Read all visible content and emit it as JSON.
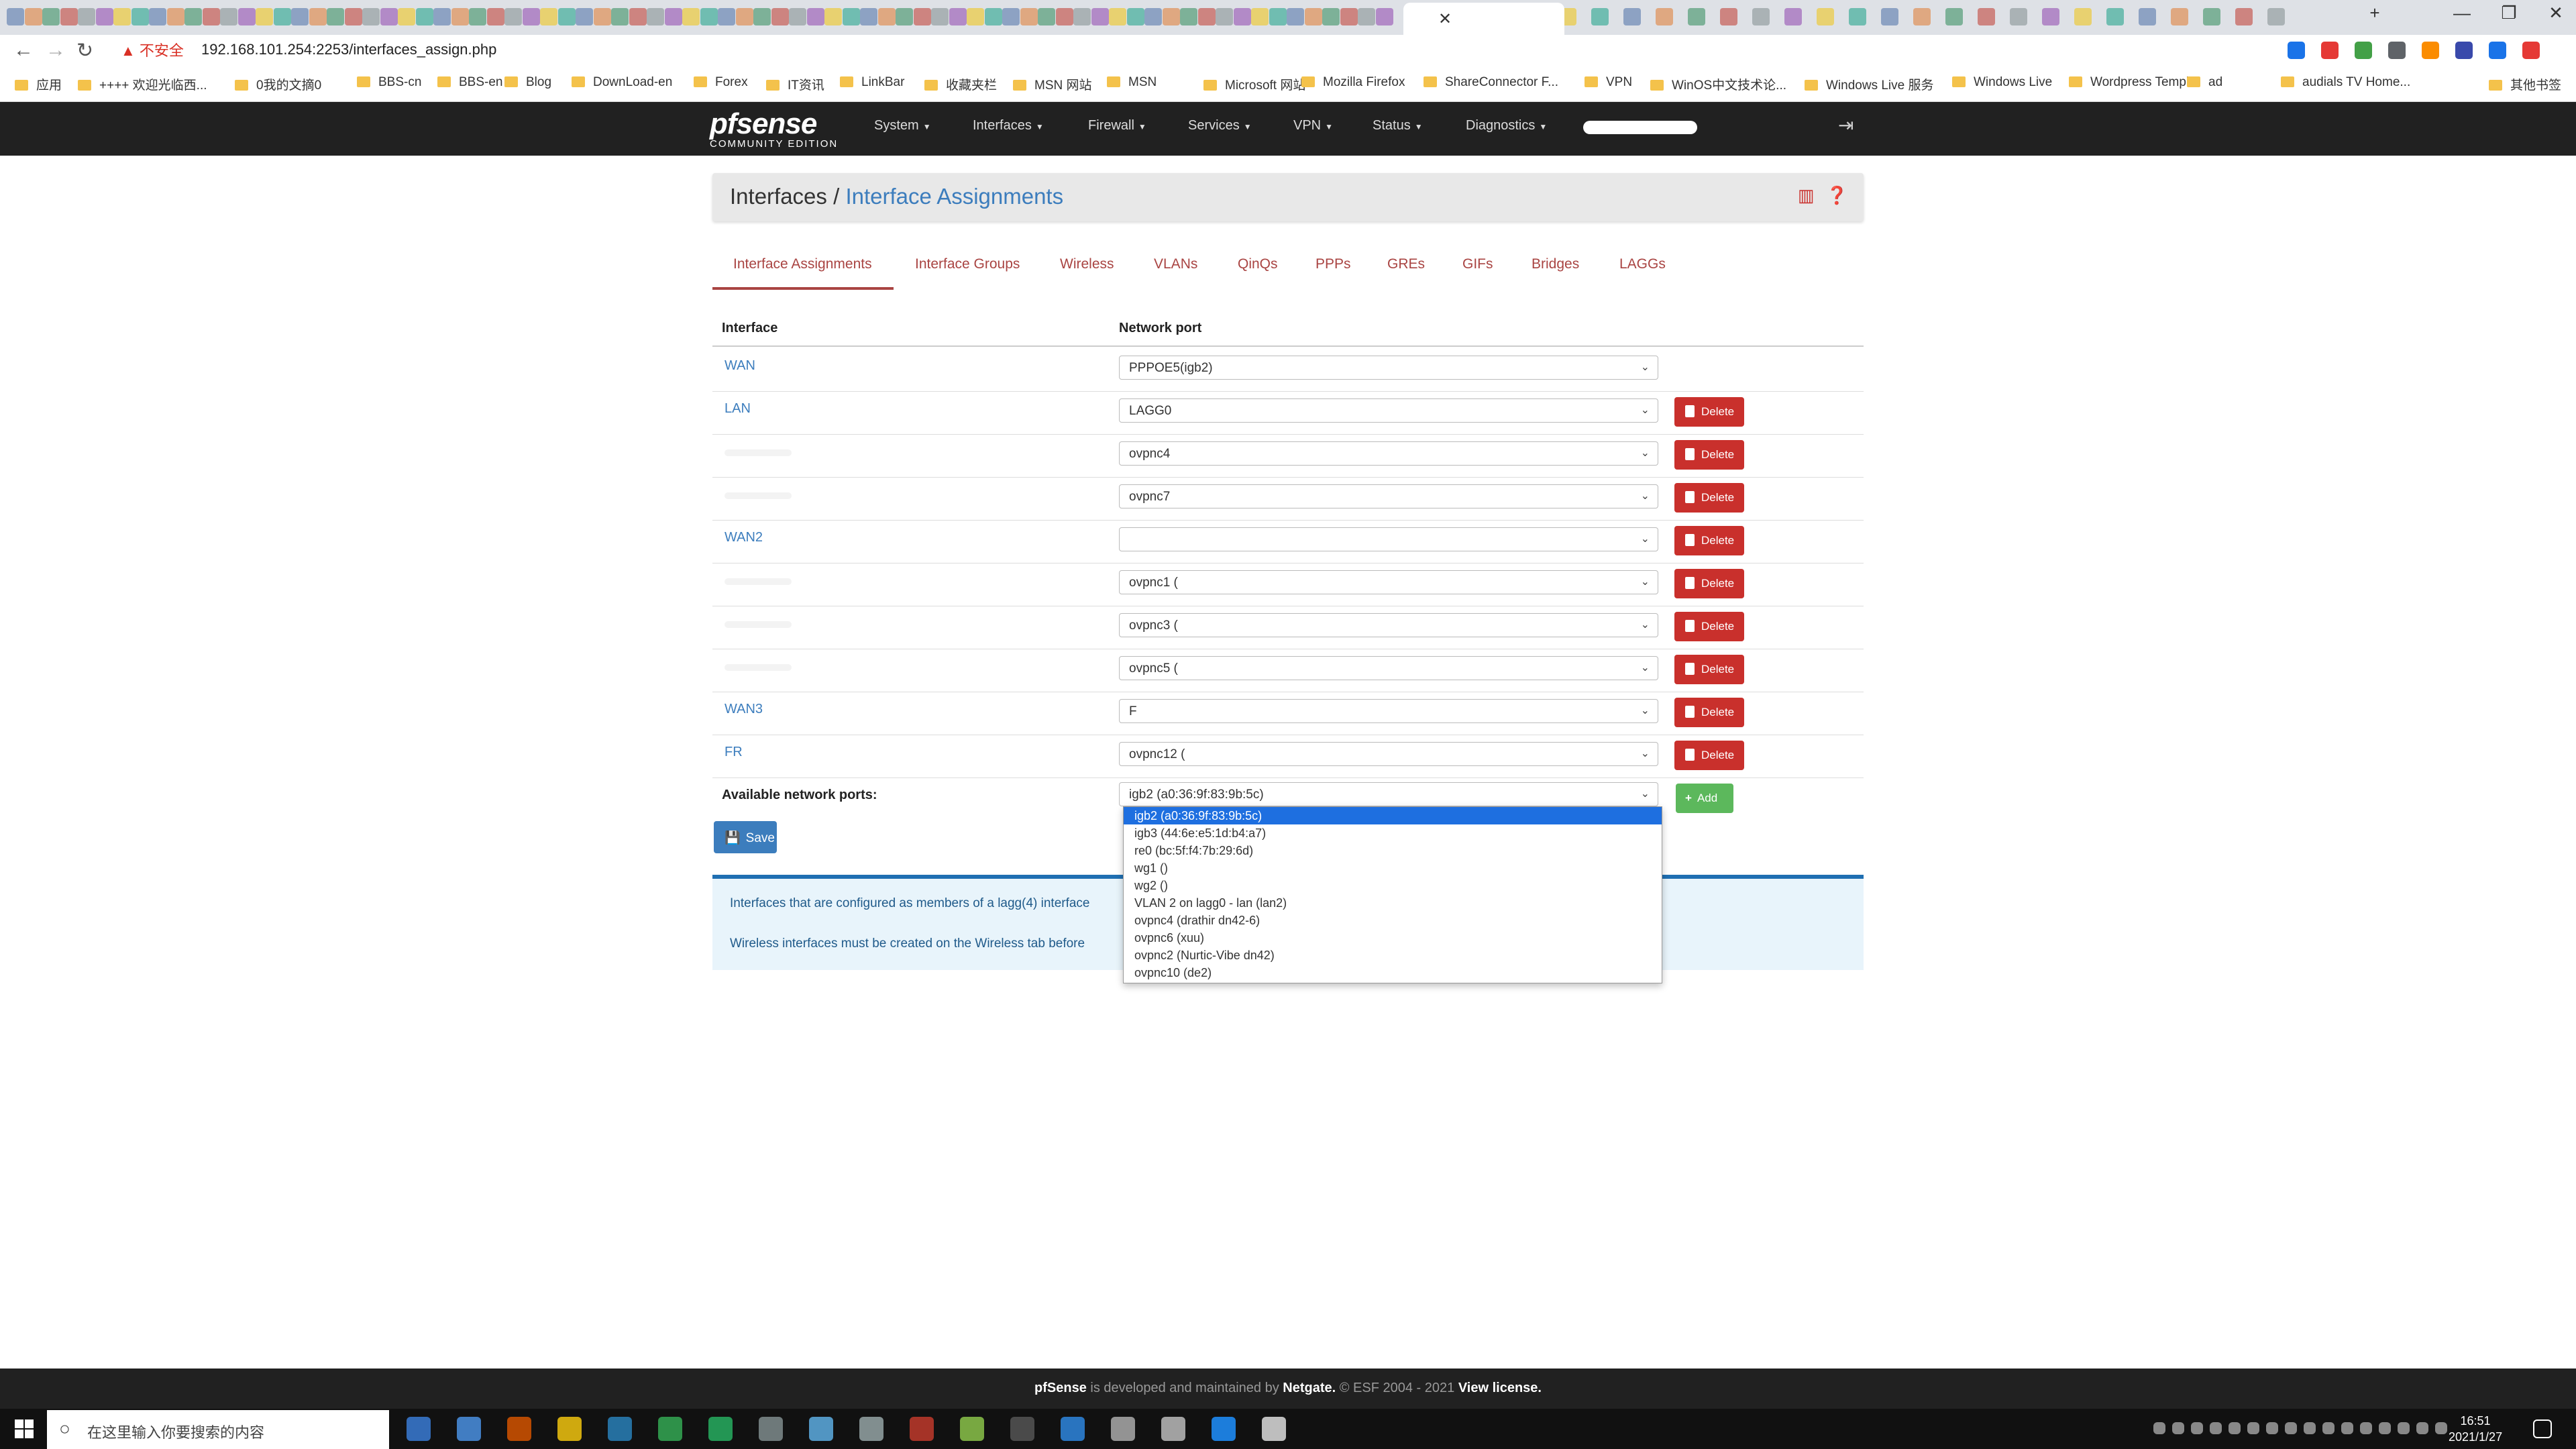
{
  "browser": {
    "url_warning": "不安全",
    "url": "192.168.101.254:2253/interfaces_assign.php",
    "bookmarks": [
      "应用",
      "++++ 欢迎光临西...",
      "0我的文摘0",
      "BBS-cn",
      "BBS-en",
      "Blog",
      "DownLoad-en",
      "Forex",
      "IT资讯",
      "LinkBar",
      "收藏夹栏",
      "MSN 网站",
      "MSN",
      "Microsoft 网站",
      "Mozilla Firefox",
      "ShareConnector F...",
      "VPN",
      "WinOS中文技术论...",
      "Windows Live 服务",
      "Windows Live",
      "Wordpress Templ...",
      "ad",
      "audials TV Home...",
      "其他书签"
    ]
  },
  "navbar": {
    "logo": "pfsense",
    "logo_sub": "COMMUNITY EDITION",
    "menu": [
      "System",
      "Interfaces",
      "Firewall",
      "Services",
      "VPN",
      "Status",
      "Diagnostics"
    ]
  },
  "header": {
    "title": "Interfaces",
    "separator": "/",
    "subtitle": "Interface Assignments"
  },
  "tabs": [
    "Interface Assignments",
    "Interface Groups",
    "Wireless",
    "VLANs",
    "QinQs",
    "PPPs",
    "GREs",
    "GIFs",
    "Bridges",
    "LAGGs"
  ],
  "table": {
    "col_interface": "Interface",
    "col_port": "Network port",
    "delete_label": "Delete",
    "rows": [
      {
        "name": "WAN",
        "port": "PPPOE5(igb2)"
      },
      {
        "name": "LAN",
        "port": "LAGG0"
      },
      {
        "name": "",
        "port": "ovpnc4"
      },
      {
        "name": "",
        "port": "ovpnc7"
      },
      {
        "name": "WAN2",
        "port": ""
      },
      {
        "name": "",
        "port": "ovpnc1 ("
      },
      {
        "name": "",
        "port": "ovpnc3 ("
      },
      {
        "name": "",
        "port": "ovpnc5 ("
      },
      {
        "name": "WAN3",
        "port": "F"
      },
      {
        "name": "FR",
        "port": "ovpnc12 ("
      }
    ]
  },
  "available": {
    "label": "Available network ports:",
    "selected": "igb2 (a0:36:9f:83:9b:5c)",
    "add_label": "Add",
    "options": [
      "igb2 (a0:36:9f:83:9b:5c)",
      "igb3 (44:6e:e5:1d:b4:a7)",
      "re0 (bc:5f:f4:7b:29:6d)",
      "wg1 ()",
      "wg2 ()",
      "VLAN 2 on lagg0 - lan (lan2)",
      "ovpnc4 (drathir dn42-6)",
      "ovpnc6 (xuu)",
      "ovpnc2 (Nurtic-Vibe dn42)",
      "ovpnc10 (de2)"
    ]
  },
  "save_label": "Save",
  "info": {
    "line1": "Interfaces that are configured as members of a lagg(4) interface",
    "line2": "Wireless interfaces must be created on the Wireless tab before"
  },
  "footer": {
    "brand": "pfSense",
    "text1": "is developed and maintained by",
    "netgate": "Netgate.",
    "text2": "© ESF 2004 - 2021",
    "license": "View license."
  },
  "taskbar": {
    "search_placeholder": "在这里输入你要搜索的内容",
    "time": "16:51",
    "date": "2021/1/27"
  }
}
